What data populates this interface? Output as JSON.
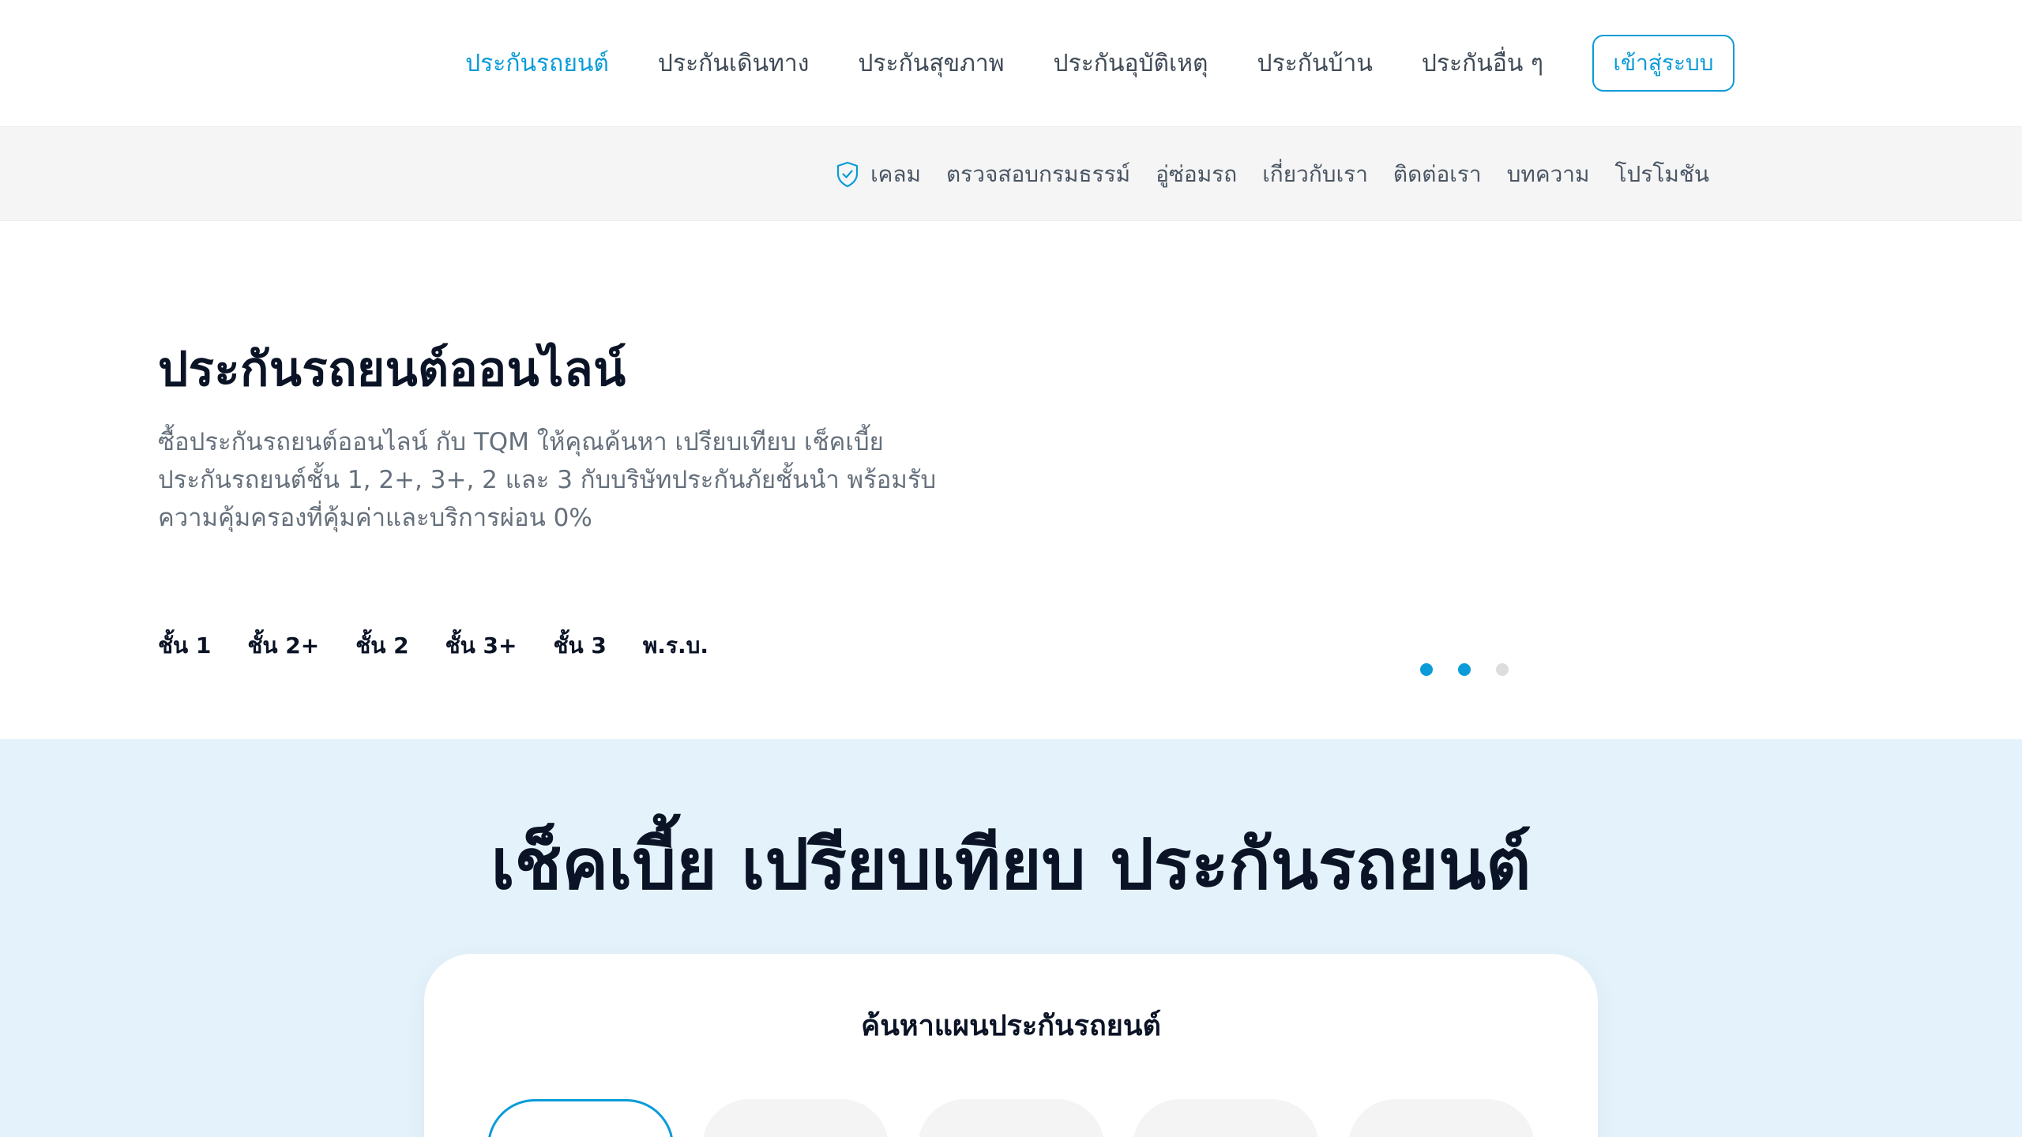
{
  "nav": {
    "items": [
      {
        "label": "ประกันรถยนต์",
        "active": true
      },
      {
        "label": "ประกันเดินทาง",
        "active": false
      },
      {
        "label": "ประกันสุขภาพ",
        "active": false
      },
      {
        "label": "ประกันอุบัติเหตุ",
        "active": false
      },
      {
        "label": "ประกันบ้าน",
        "active": false
      },
      {
        "label": "ประกันอื่น ๆ",
        "active": false
      }
    ],
    "login_label": "เข้าสู่ระบบ"
  },
  "subnav": {
    "items": [
      {
        "label": "เคลม",
        "icon": "shield-check-icon"
      },
      {
        "label": "ตรวจสอบกรมธรรม์"
      },
      {
        "label": "อู่ซ่อมรถ"
      },
      {
        "label": "เกี่ยวกับเรา"
      },
      {
        "label": "ติดต่อเรา"
      },
      {
        "label": "บทความ"
      },
      {
        "label": "โปรโมชัน"
      }
    ]
  },
  "hero": {
    "title": "ประกันรถยนต์ออนไลน์",
    "description": "ซื้อประกันรถยนต์ออนไลน์ กับ TQM ให้คุณค้นหา เปรียบเทียบ เช็คเบี้ยประกันรถยนต์ชั้น 1, 2+, 3+, 2 และ 3 กับบริษัทประกันภัยชั้นนำ พร้อมรับความคุ้มครองที่คุ้มค่าและบริการผ่อน 0%",
    "tiers": [
      "ชั้น 1",
      "ชั้น 2+",
      "ชั้น 2",
      "ชั้น 3+",
      "ชั้น 3",
      "พ.ร.บ."
    ],
    "carousel": {
      "count": 3,
      "active_dots": [
        0,
        1
      ]
    }
  },
  "compare": {
    "heading": "เช็คเบี้ย เปรียบเทียบ ประกันรถยนต์",
    "card_title": "ค้นหาแผนประกันรถยนต์"
  },
  "colors": {
    "accent": "#0a9bd8",
    "text_dark": "#0b1426",
    "section_bg": "#e4f3fb",
    "dot_inactive": "#dddddd"
  }
}
